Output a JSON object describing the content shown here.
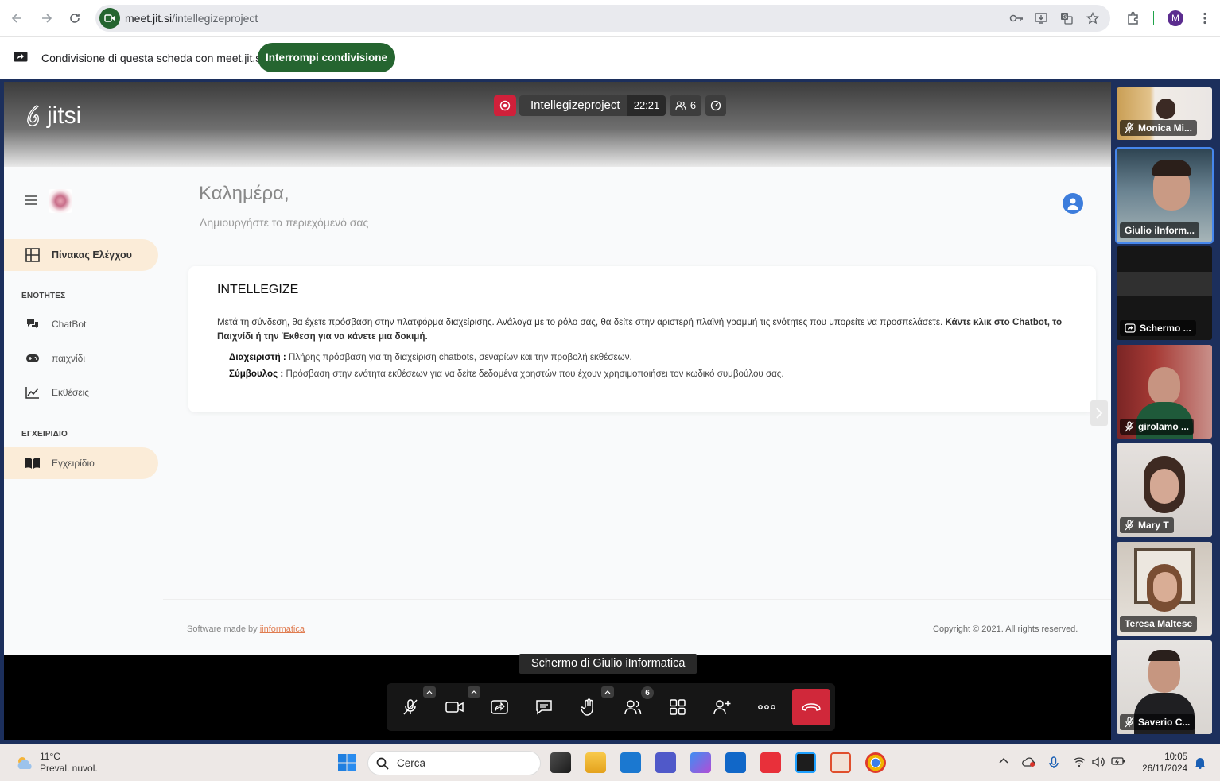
{
  "browser": {
    "url_host": "meet.jit.si",
    "url_path": "/intellegizeproject",
    "profile_initial": "M"
  },
  "share_banner": {
    "text": "Condivisione di questa scheda con meet.jit.si",
    "stop_button": "Interrompi condivisione"
  },
  "meeting": {
    "logo_text": "jitsi",
    "name": "Intellegizeproject",
    "time": "22:21",
    "participant_count": "6",
    "screen_label": "Schermo di Giulio iInformatica",
    "toolbar_participant_badge": "6"
  },
  "shared_app": {
    "greeting": "Καλημέρα,",
    "greeting_sub": "Δημιουργήστε το περιεχόμενό σας",
    "nav": {
      "dashboard": "Πίνακας Ελέγχου",
      "section_modules": "ΕΝΟΤΗΤΕΣ",
      "chatbot": "ChatBot",
      "game": "παιχνίδι",
      "reports": "Εκθέσεις",
      "section_manual": "ΕΓΧΕΙΡΙΔΙΟ",
      "manual": "Εγχειρίδιο"
    },
    "card": {
      "title": "INTELLEGIZE",
      "body": "Μετά τη σύνδεση, θα έχετε πρόσβαση στην πλατφόρμα διαχείρισης.  Ανάλογα με το ρόλο σας, θα δείτε στην αριστερή πλαϊνή γραμμή τις ενότητες που μπορείτε να προσπελάσετε.",
      "body_bold": "Κάντε κλικ στο Chatbot, το Παιχνίδι ή την Έκθεση για να κάνετε μια δοκιμή.",
      "admin_label": "Διαχειριστή :",
      "admin_text": " Πλήρης πρόσβαση για τη διαχείριση chatbots, σεναρίων και την προβολή εκθέσεων.",
      "advisor_label": "Σύμβουλος :",
      "advisor_text": " Πρόσβαση στην ενότητα εκθέσεων για να δείτε δεδομένα χρηστών που έχουν χρησιμοποιήσει τον κωδικό συμβούλου σας."
    },
    "footer_left": "Software made by ",
    "footer_link": "iinformatica",
    "footer_right": "Copyright © 2021. All rights reserved."
  },
  "participants": [
    {
      "name": "Monica Mi..."
    },
    {
      "name": "Giulio iInform..."
    },
    {
      "name": "Schermo ..."
    },
    {
      "name": "girolamo ..."
    },
    {
      "name": "Mary T"
    },
    {
      "name": "Teresa Maltese"
    },
    {
      "name": "Saverio C..."
    }
  ],
  "taskbar": {
    "temp": "11°C",
    "weather": "Preval. nuvol.",
    "search_placeholder": "Cerca",
    "time": "10:05",
    "date": "26/11/2024"
  },
  "colors": {
    "accent_green": "#256530",
    "jitsi_frame": "#1c2f5c",
    "hangup_red": "#d0283a",
    "record_red": "#d0203a",
    "nav_active_bg": "#fbecd8"
  }
}
